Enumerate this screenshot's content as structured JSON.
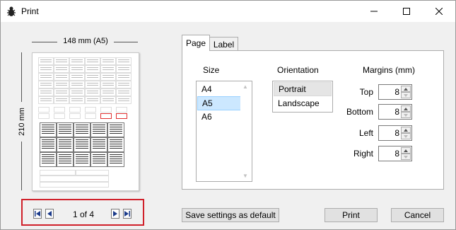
{
  "window": {
    "title": "Print"
  },
  "titlebar": {
    "minimize_icon": "minimize-icon",
    "maximize_icon": "maximize-icon",
    "close_icon": "close-icon"
  },
  "preview": {
    "width_label": "148 mm (A5)",
    "height_label": "210 mm"
  },
  "navigation": {
    "page_indicator": "1 of 4"
  },
  "tabs": [
    {
      "label": "Page",
      "selected": true
    },
    {
      "label": "Label",
      "selected": false
    }
  ],
  "size": {
    "header": "Size",
    "options": [
      "A4",
      "A5",
      "A6"
    ],
    "selected": "A5"
  },
  "orientation": {
    "header": "Orientation",
    "options": [
      "Portrait",
      "Landscape"
    ],
    "selected": "Portrait"
  },
  "margins": {
    "header": "Margins (mm)",
    "fields": [
      {
        "label": "Top",
        "value": "8"
      },
      {
        "label": "Bottom",
        "value": "8"
      },
      {
        "label": "Left",
        "value": "8"
      },
      {
        "label": "Right",
        "value": "8"
      }
    ]
  },
  "buttons": {
    "save_default": "Save settings as default",
    "print": "Print",
    "cancel": "Cancel"
  },
  "colors": {
    "highlight_frame": "#d0202a",
    "selection": "#cce8ff"
  }
}
